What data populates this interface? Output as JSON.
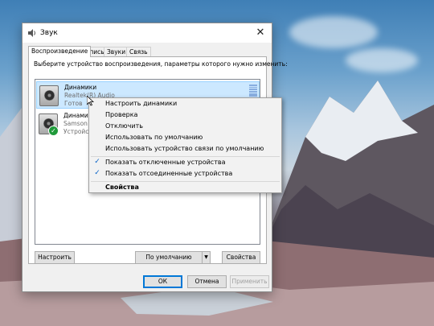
{
  "dialog": {
    "title": "Звук",
    "tabs": [
      "Воспроизведение",
      "Запись",
      "Звуки",
      "Связь"
    ],
    "instruction": "Выберите устройство воспроизведения, параметры которого нужно изменить:",
    "devices": [
      {
        "name": "Динамики",
        "driver": "Realtek(R) Audio",
        "status": "Готов",
        "icon": "speaker-icon",
        "selected": true
      },
      {
        "name": "Динамики",
        "driver": "Samson C",
        "status": "Устройств",
        "icon": "speaker-icon",
        "default_badge": "check-icon"
      }
    ],
    "buttons": {
      "configure": "Настроить",
      "set_default": "По умолчанию",
      "properties": "Свойства",
      "ok": "ОК",
      "cancel": "Отмена",
      "apply": "Применить"
    }
  },
  "context_menu": {
    "items": [
      {
        "label": "Настроить динамики"
      },
      {
        "label": "Проверка"
      },
      {
        "label": "Отключить"
      },
      {
        "label": "Использовать по умолчанию"
      },
      {
        "label": "Использовать устройство связи по умолчанию"
      },
      {
        "label": "Показать отключенные устройства",
        "checked": true
      },
      {
        "label": "Показать отсоединенные устройства",
        "checked": true
      },
      {
        "label": "Свойства",
        "bold": true
      }
    ]
  },
  "colors": {
    "selection": "#cce8ff",
    "accent": "#0078d7",
    "check": "#0a64c8",
    "default_badge": "#1f9a3a"
  }
}
